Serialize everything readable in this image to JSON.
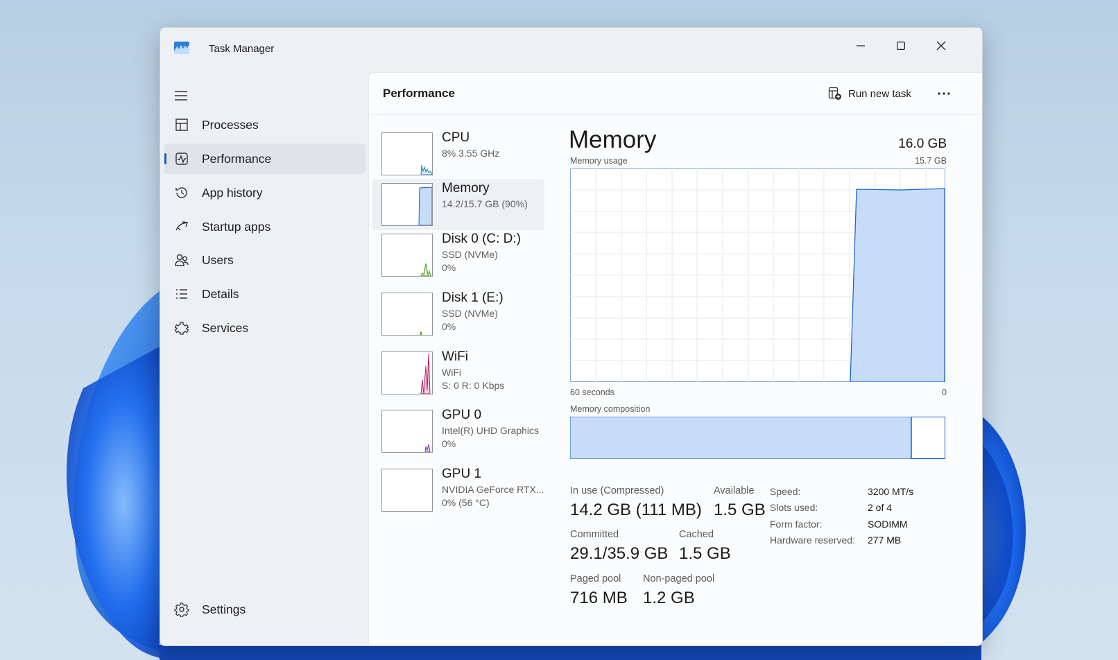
{
  "window": {
    "title": "Task Manager"
  },
  "nav": {
    "items": [
      {
        "label": "Processes",
        "icon": "processes-icon"
      },
      {
        "label": "Performance",
        "icon": "performance-icon",
        "active": true
      },
      {
        "label": "App history",
        "icon": "history-icon"
      },
      {
        "label": "Startup apps",
        "icon": "startup-icon"
      },
      {
        "label": "Users",
        "icon": "users-icon"
      },
      {
        "label": "Details",
        "icon": "details-icon"
      },
      {
        "label": "Services",
        "icon": "services-icon"
      }
    ],
    "settings": "Settings"
  },
  "header": {
    "title": "Performance",
    "run_task": "Run new task"
  },
  "devices": [
    {
      "name": "CPU",
      "line1": "8%  3.55 GHz",
      "line2": "",
      "color": "#1a86c4"
    },
    {
      "name": "Memory",
      "line1": "14.2/15.7 GB (90%)",
      "line2": "",
      "color": "#1560c5",
      "active": true
    },
    {
      "name": "Disk 0 (C: D:)",
      "line1": "SSD (NVMe)",
      "line2": "0%",
      "color": "#4d9a16"
    },
    {
      "name": "Disk 1 (E:)",
      "line1": "SSD (NVMe)",
      "line2": "0%",
      "color": "#4d9a16"
    },
    {
      "name": "WiFi",
      "line1": "WiFi",
      "line2": "S: 0  R: 0 Kbps",
      "color": "#b0196e"
    },
    {
      "name": "GPU 0",
      "line1": "Intel(R) UHD Graphics",
      "line2": "0%",
      "color": "#7a2fbf"
    },
    {
      "name": "GPU 1",
      "line1": "NVIDIA GeForce RTX...",
      "line2": "0%  (56 °C)",
      "color": "#7a2fbf"
    }
  ],
  "memory": {
    "title": "Memory",
    "total": "16.0 GB",
    "usage_label": "Memory usage",
    "usage_max": "15.7 GB",
    "axis_left": "60 seconds",
    "axis_right": "0",
    "composition_label": "Memory composition",
    "in_use_fraction": 0.91,
    "stats": {
      "in_use_label": "In use (Compressed)",
      "in_use": "14.2 GB (111 MB)",
      "available_label": "Available",
      "available": "1.5 GB",
      "committed_label": "Committed",
      "committed": "29.1/35.9 GB",
      "cached_label": "Cached",
      "cached": "1.5 GB",
      "paged_label": "Paged pool",
      "paged": "716 MB",
      "nonpaged_label": "Non-paged pool",
      "nonpaged": "1.2 GB"
    },
    "specs": {
      "speed_label": "Speed:",
      "speed": "3200 MT/s",
      "slots_label": "Slots used:",
      "slots": "2 of 4",
      "form_label": "Form factor:",
      "form": "SODIMM",
      "reserved_label": "Hardware reserved:",
      "reserved": "277 MB"
    }
  },
  "colors": {
    "accent": "#1560c5",
    "memory_fill": "#c6dcf8",
    "memory_line": "#1560c5"
  }
}
